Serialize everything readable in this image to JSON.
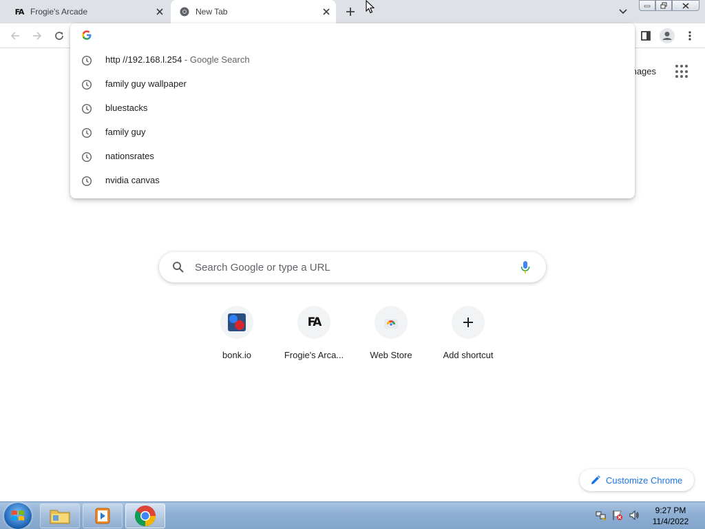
{
  "tabs": [
    {
      "title": "Frogie's Arcade",
      "favicon": "FA"
    },
    {
      "title": "New Tab"
    }
  ],
  "omnibox": {
    "value": "",
    "suggestions": [
      {
        "text": "http //192.168.l.254",
        "suffix": " - Google Search"
      },
      {
        "text": "family guy wallpaper",
        "suffix": ""
      },
      {
        "text": "bluestacks",
        "suffix": ""
      },
      {
        "text": "family guy",
        "suffix": ""
      },
      {
        "text": "nationsrates",
        "suffix": ""
      },
      {
        "text": "nvidia canvas",
        "suffix": ""
      }
    ]
  },
  "header": {
    "images_label": "mages"
  },
  "search": {
    "placeholder": "Search Google or type a URL"
  },
  "shortcuts": [
    {
      "label": "bonk.io",
      "icon": "bonk-icon"
    },
    {
      "label": "Frogie's Arca...",
      "icon": "FA"
    },
    {
      "label": "Web Store",
      "icon": "web-store-icon"
    },
    {
      "label": "Add shortcut",
      "icon": "plus-icon"
    }
  ],
  "customize": {
    "label": "Customize Chrome"
  },
  "taskbar": {
    "time": "9:27 PM",
    "date": "11/4/2022"
  },
  "colors": {
    "accent": "#1a73e8",
    "tabstrip": "#dee1e6"
  }
}
